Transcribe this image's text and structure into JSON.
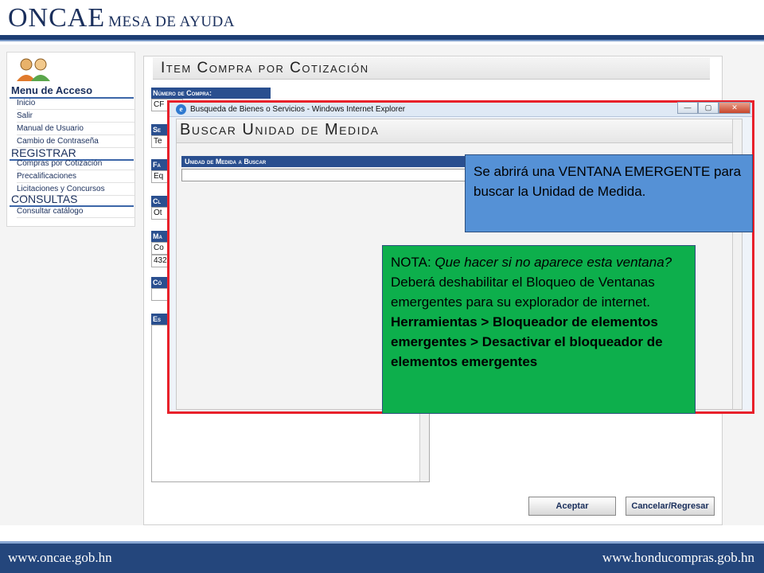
{
  "header": {
    "brand_main": "ONCAE",
    "brand_sub": "MESA DE AYUDA"
  },
  "footer": {
    "left_link": "www.oncae.gob.hn",
    "right_link": "www.honducompras.gob.hn"
  },
  "sidebar": {
    "menu_title": "Menu de Acceso",
    "items_top": [
      "Inicio",
      "Salir",
      "Manual de Usuario",
      "Cambio de Contraseña"
    ],
    "register_title": "REGISTRAR",
    "items_register": [
      "Compras por Cotización",
      "Precalificaciones",
      "Licitaciones y Concursos"
    ],
    "consult_title": "CONSULTAS",
    "items_consult": [
      "Consultar catálogo"
    ]
  },
  "form": {
    "title": "Item Compra por Cotización",
    "fields": [
      {
        "label": "Número de Compra:",
        "value": "CF"
      },
      {
        "label": "Se",
        "value": "Te"
      },
      {
        "label": "Fa",
        "value": "Eq"
      },
      {
        "label": "Cl",
        "value": "Ot"
      },
      {
        "label": "Ma",
        "value": "Co",
        "value2": "432"
      },
      {
        "label": "Có",
        "value": ""
      },
      {
        "label": "Es",
        "value": ""
      }
    ],
    "accept_button": "Aceptar",
    "cancel_button": "Cancelar/Regresar"
  },
  "popup": {
    "window_title": "Busqueda de Bienes o Servicios - Windows Internet Explorer",
    "ie_glyph": "e",
    "minimize": "—",
    "maximize": "▢",
    "close": "✕",
    "heading": "Buscar Unidad de Medida",
    "search_label": "Unidad de Medida a Buscar",
    "search_value": ""
  },
  "callouts": {
    "blue_text": "Se abrirá una VENTANA EMERGENTE para buscar la Unidad de Medida.",
    "green_prefix": "NOTA: ",
    "green_italic": "Que hacer si no aparece esta ventana?",
    "green_text": " Deberá deshabilitar el Bloqueo de Ventanas emergentes para su explorador de internet.",
    "green_bold": "Herramientas > Bloqueador de elementos emergentes > Desactivar el bloqueador de elementos emergentes"
  }
}
